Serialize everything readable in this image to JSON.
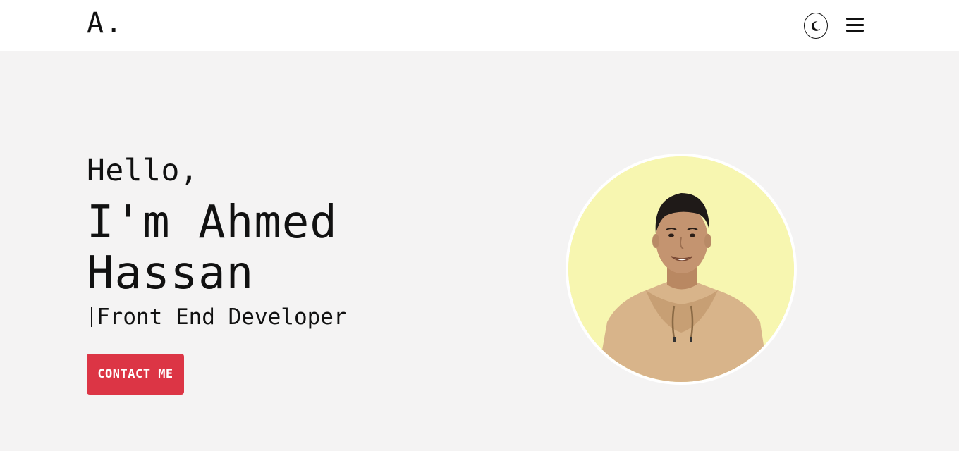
{
  "header": {
    "logo": "A.",
    "theme_toggle_icon": "moon-icon",
    "menu_icon": "hamburger-menu-icon"
  },
  "hero": {
    "greeting": "Hello,",
    "name_line1": "I'm Ahmed",
    "name_line2": "Hassan",
    "role": "Front End Developer",
    "contact_label": "CONTACT ME"
  },
  "colors": {
    "accent": "#dc3545",
    "background": "#f4f3f3",
    "avatar_bg": "#f7f6b0"
  }
}
